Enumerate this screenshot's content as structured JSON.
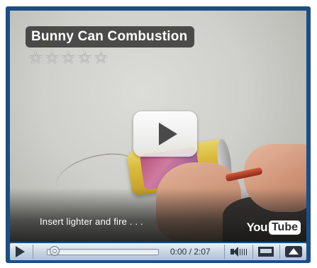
{
  "video": {
    "title": "Bunny Can Combustion",
    "rating_stars": 0,
    "rating_max": 5,
    "caption": "Insert lighter and fire . . .",
    "logo_you": "You",
    "logo_tube": "Tube"
  },
  "controls": {
    "time_display": "0:00 / 2:07",
    "progress": 0
  },
  "icons": {
    "big_play": "play-icon",
    "play": "play-icon",
    "volume": "volume-icon",
    "size": "window-size-icon",
    "fullscreen": "expand-up-icon",
    "star": "star-outline-icon"
  },
  "colors": {
    "frame": "#1a4e85",
    "control_bar": "#c9d6e4",
    "title_bg": "#323232"
  }
}
